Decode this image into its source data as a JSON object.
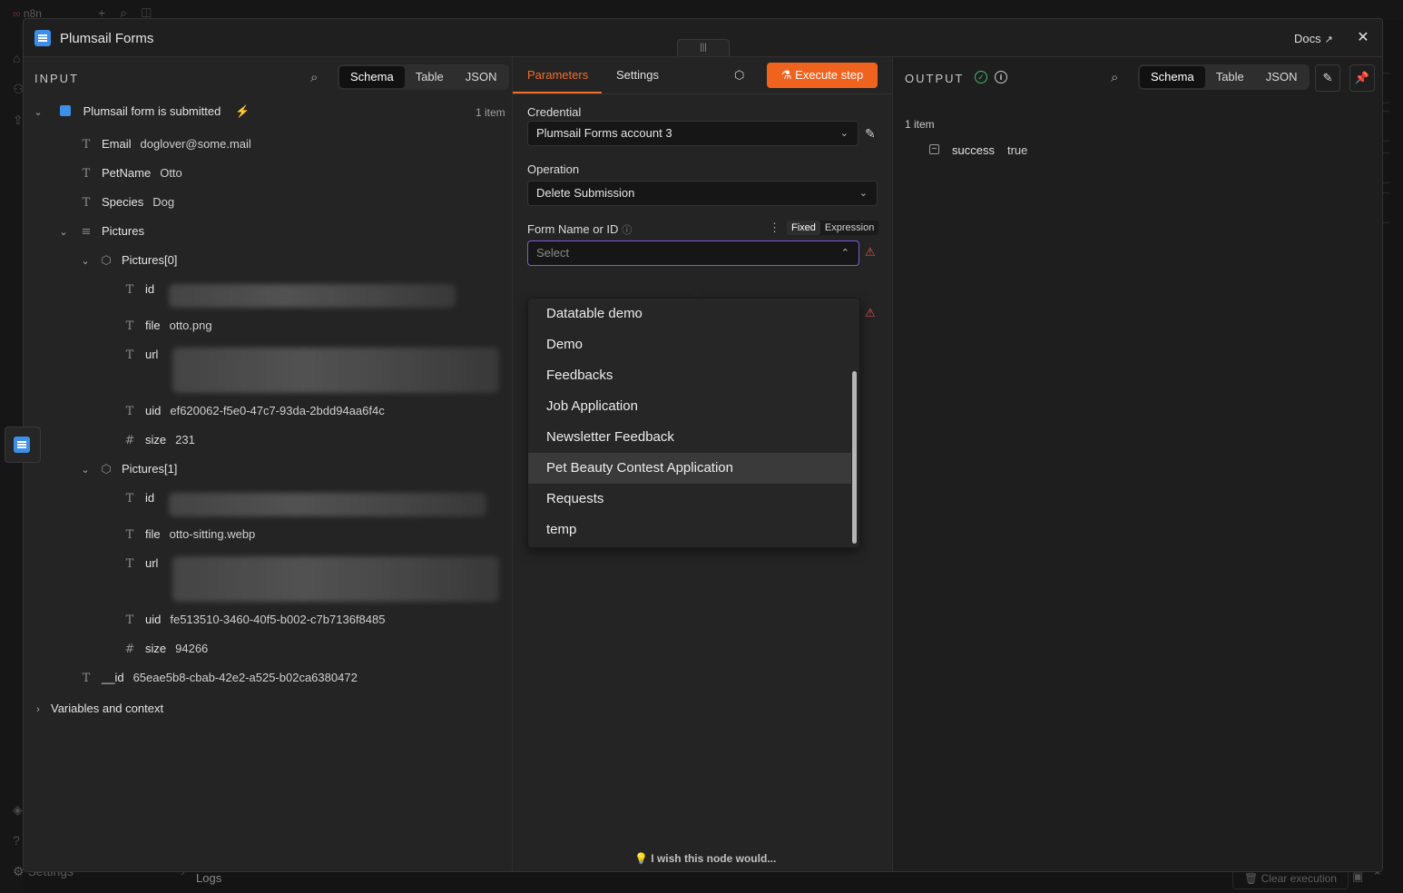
{
  "background": {
    "app_name": "n8n",
    "settings_label": "Settings",
    "logs_label": "Logs",
    "clear_execution_label": "Clear execution"
  },
  "modal": {
    "title": "Plumsail Forms",
    "docs_label": "Docs",
    "close_label": "✕",
    "accent_color": "#3d8fe8"
  },
  "input": {
    "label": "INPUT",
    "views": [
      "Schema",
      "Table",
      "JSON"
    ],
    "active_view": "Schema",
    "trigger": {
      "name": "Plumsail form is submitted",
      "count": "1 item"
    },
    "fields": [
      {
        "key": "Email",
        "value": "doglover@some.mail"
      },
      {
        "key": "PetName",
        "value": "Otto"
      },
      {
        "key": "Species",
        "value": "Dog"
      }
    ],
    "pictures_label": "Pictures",
    "picture0": {
      "label": "Pictures[0]",
      "id_key": "id",
      "file_key": "file",
      "file_value": "otto.png",
      "url_key": "url",
      "uid_key": "uid",
      "uid_value": "ef620062-f5e0-47c7-93da-2bdd94aa6f4c",
      "size_key": "size",
      "size_value": "231"
    },
    "picture1": {
      "label": "Pictures[1]",
      "id_key": "id",
      "file_key": "file",
      "file_value": "otto-sitting.webp",
      "url_key": "url",
      "uid_key": "uid",
      "uid_value": "fe513510-3460-40f5-b002-c7b7136f8485",
      "size_key": "size",
      "size_value": "94266"
    },
    "record_id": {
      "key": "__id",
      "value": "65eae5b8-cbab-42e2-a525-b02ca6380472"
    },
    "variables_label": "Variables and context"
  },
  "parameters": {
    "tabs": [
      "Parameters",
      "Settings"
    ],
    "execute_label": "Execute step",
    "credential_label": "Credential",
    "credential_value": "Plumsail Forms account 3",
    "operation_label": "Operation",
    "operation_value": "Delete Submission",
    "form_label": "Form Name or ID",
    "form_mode_fixed": "Fixed",
    "form_mode_expression": "Expression",
    "form_placeholder": "Select",
    "form_options": [
      "Datatable demo",
      "Demo",
      "Feedbacks",
      "Job Application",
      "Newsletter Feedback",
      "Pet Beauty Contest Application",
      "Requests",
      "temp"
    ],
    "highlighted_option": "Pet Beauty Contest Application",
    "wish_label": "I wish this node would..."
  },
  "output": {
    "label": "OUTPUT",
    "views": [
      "Schema",
      "Table",
      "JSON"
    ],
    "active_view": "Schema",
    "count": "1 item",
    "result": {
      "key": "success",
      "value": "true"
    },
    "status_color": "#3fb96b"
  },
  "colors": {
    "accent_orange": "#f0631f",
    "focus_purple": "#7d5cd8",
    "warning_red": "#e05555"
  }
}
